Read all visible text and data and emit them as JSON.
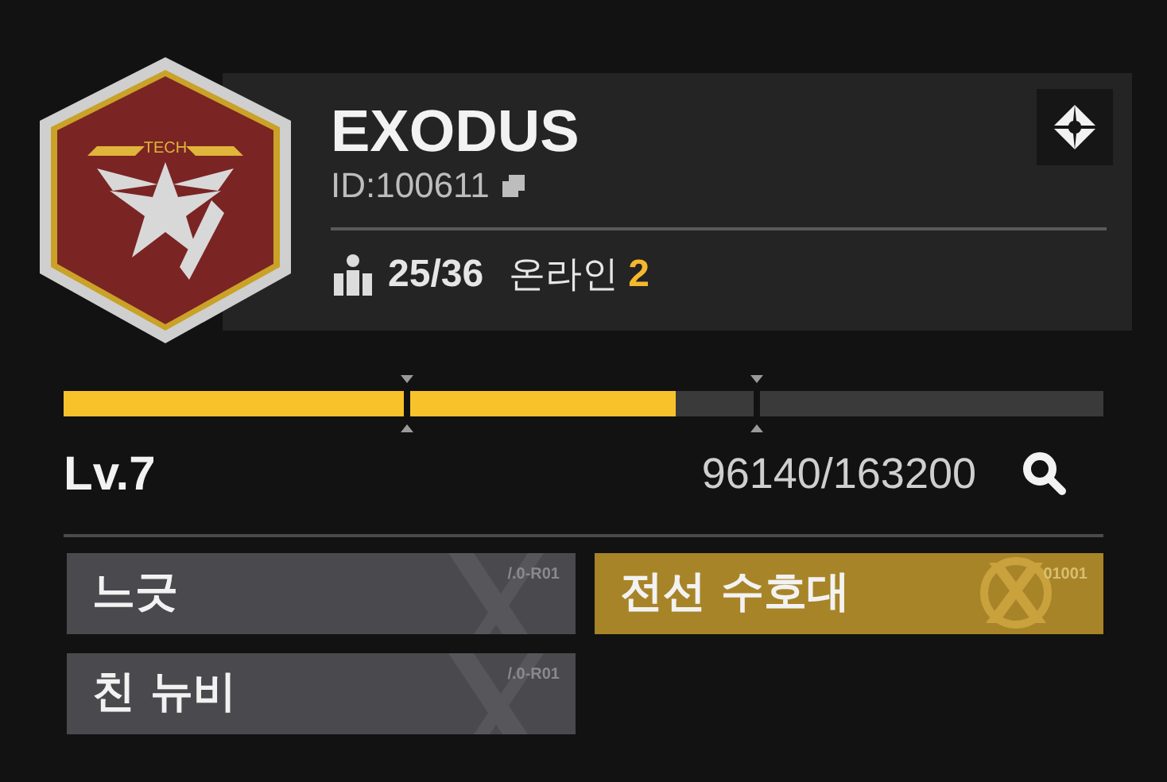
{
  "emblem": {
    "text": "TECH"
  },
  "guild": {
    "name": "EXODUS",
    "id": "ID:100611",
    "members": "25/36",
    "online_label": "온라인",
    "online_count": "2"
  },
  "progress": {
    "level": 0.589,
    "milestones": [
      {
        "level": 0.331
      },
      {
        "level": 0.667
      }
    ]
  },
  "level_label": "Lv.7",
  "exp": "96140/163200",
  "tags": [
    {
      "label": "느긋",
      "code": "/.0-R01",
      "kind": "grey"
    },
    {
      "label": "전선 수호대",
      "code": "01001",
      "kind": "gold"
    },
    {
      "label": "친 뉴비",
      "code": "/.0-R01",
      "kind": "grey"
    }
  ]
}
